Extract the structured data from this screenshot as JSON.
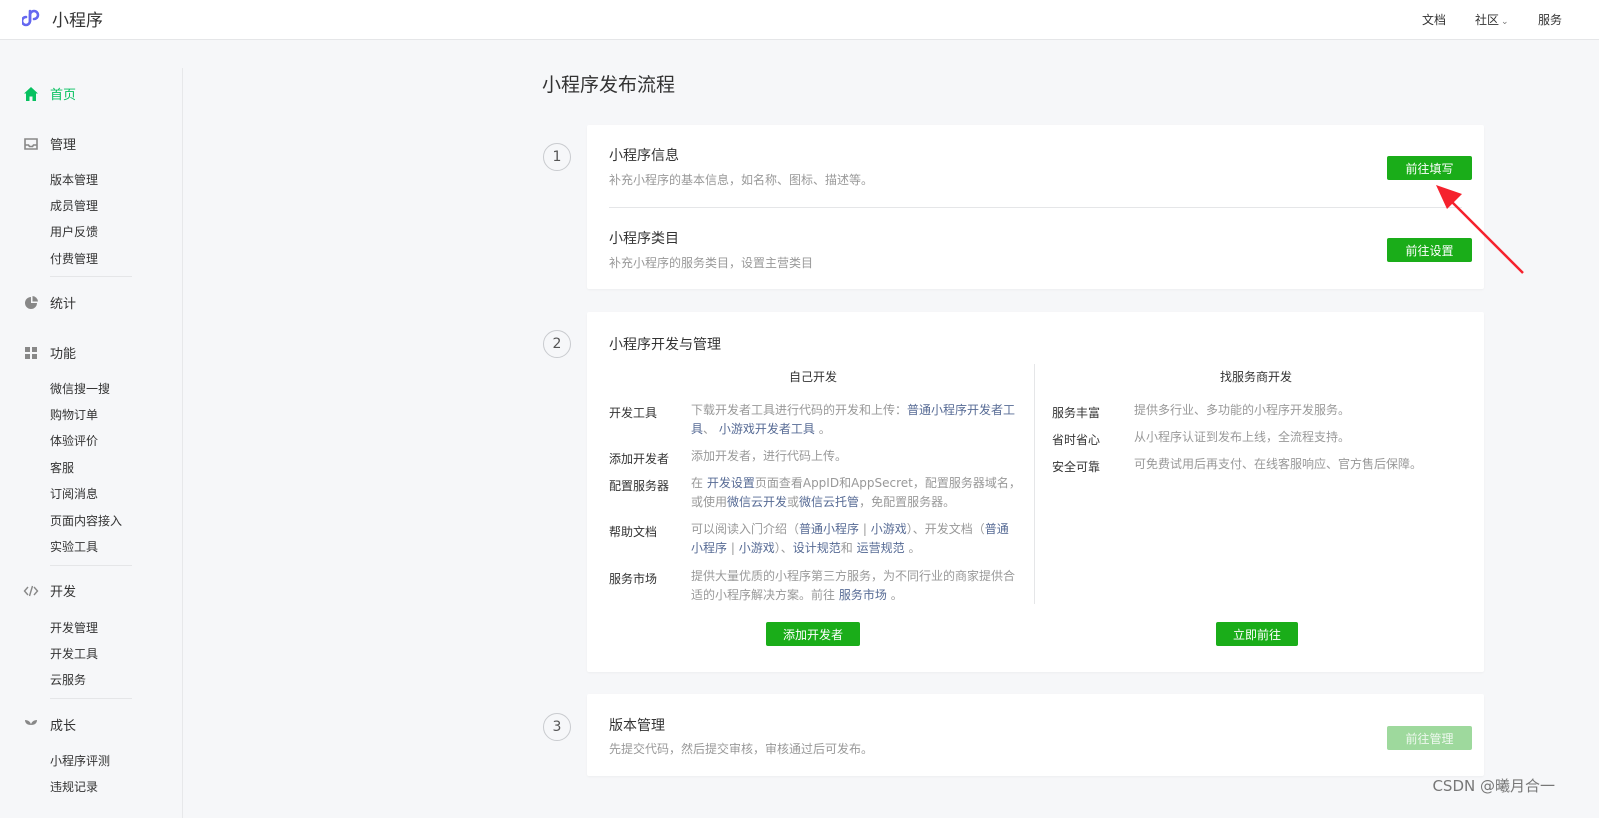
{
  "header": {
    "app_name": "小程序",
    "nav": [
      {
        "label": "文档"
      },
      {
        "label": "社区",
        "chevron": "⌄"
      },
      {
        "label": "服务"
      }
    ]
  },
  "sidebar": {
    "home": {
      "label": "首页",
      "icon": "home-icon"
    },
    "manage": {
      "label": "管理",
      "icon": "inbox-icon",
      "items": [
        "版本管理",
        "成员管理",
        "用户反馈",
        "付费管理"
      ]
    },
    "stats": {
      "label": "统计",
      "icon": "pie-chart-icon"
    },
    "features": {
      "label": "功能",
      "icon": "grid-icon",
      "items": [
        "微信搜一搜",
        "购物订单",
        "体验评价",
        "客服",
        "订阅消息",
        "页面内容接入",
        "实验工具"
      ]
    },
    "dev": {
      "label": "开发",
      "icon": "code-icon",
      "items": [
        "开发管理",
        "开发工具",
        "云服务"
      ]
    },
    "growth": {
      "label": "成长",
      "icon": "sprout-icon",
      "items": [
        "小程序评测",
        "违规记录"
      ]
    }
  },
  "main": {
    "title": "小程序发布流程",
    "steps": [
      {
        "number": "1",
        "items": [
          {
            "title": "小程序信息",
            "desc": "补充小程序的基本信息，如名称、图标、描述等。",
            "button": "前往填写"
          },
          {
            "title": "小程序类目",
            "desc": "补充小程序的服务类目，设置主营类目",
            "button": "前往设置"
          }
        ]
      },
      {
        "number": "2",
        "title": "小程序开发与管理",
        "self_dev": {
          "title": "自己开发",
          "rows": [
            {
              "label": "开发工具",
              "text1": "下载开发者工具进行代码的开发和上传：",
              "link1": "普通小程序开发者工",
              "link2": "具",
              "text2": "、",
              "link3": "小游戏开发者工具",
              "text3": "。"
            },
            {
              "label": "添加开发者",
              "text": "添加开发者，进行代码上传。"
            },
            {
              "label": "配置服务器",
              "text1": "在",
              "link1": "开发设置",
              "text2": "页面查看AppID和AppSecret，配置服务器域名，",
              "text3": "或使用",
              "link2": "微信云开发",
              "text4": "或",
              "link3": "微信云托管",
              "text5": "，免配置服务器。"
            },
            {
              "label": "帮助文档",
              "text1": "可以阅读入门介绍（",
              "link1": "普通小程序",
              "sep1": "|",
              "link2": "小游戏",
              "text2": "）、开发文档（",
              "link3": "普通",
              "link4": "小程序",
              "sep2": "|",
              "link5": "小游戏",
              "text3": "）、",
              "link6": "设计规范",
              "text4": "和",
              "link7": "运营规范",
              "text5": "。"
            },
            {
              "label": "服务市场",
              "text1": "提供大量优质的小程序第三方服务，为不同行业的商家提供合",
              "text2": "适的小程序解决方案。前往",
              "link1": "服务市场",
              "text3": "。"
            }
          ],
          "button": "添加开发者"
        },
        "provider_dev": {
          "title": "找服务商开发",
          "rows": [
            {
              "label": "服务丰富",
              "text": "提供多行业、多功能的小程序开发服务。"
            },
            {
              "label": "省时省心",
              "text": "从小程序认证到发布上线，全流程支持。"
            },
            {
              "label": "安全可靠",
              "text": "可免费试用后再支付、在线客服响应、官方售后保障。"
            }
          ],
          "button": "立即前往"
        }
      },
      {
        "number": "3",
        "title": "版本管理",
        "desc": "先提交代码，然后提交审核，审核通过后可发布。",
        "button": "前往管理",
        "button_disabled": true
      }
    ]
  },
  "watermark": "CSDN @曦月合一",
  "colors": {
    "accent_green": "#07c160",
    "button_green": "#1aad19",
    "link_blue": "#576b95",
    "annotation_red": "#f5222d"
  }
}
